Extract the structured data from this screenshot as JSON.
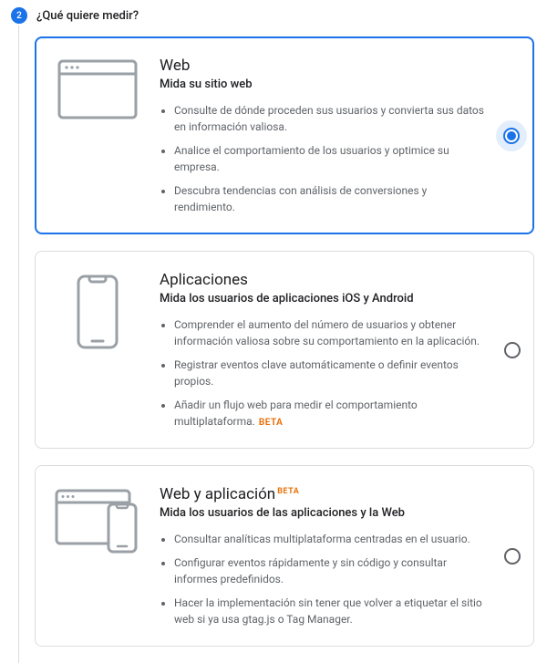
{
  "step": {
    "number": "2",
    "title": "¿Qué quiere medir?"
  },
  "options": [
    {
      "title": "Web",
      "subtitle": "Mida su sitio web",
      "bullets": [
        "Consulte de dónde proceden sus usuarios y convierta sus datos en información valiosa.",
        "Analice el comportamiento de los usuarios y optimice su empresa.",
        "Descubra tendencias con análisis de conversiones y rendimiento."
      ],
      "selected": true
    },
    {
      "title": "Aplicaciones",
      "subtitle": "Mida los usuarios de aplicaciones iOS y Android",
      "bullets": [
        "Comprender el aumento del número de usuarios y obtener información valiosa sobre su comportamiento en la aplicación.",
        "Registrar eventos clave automáticamente o definir eventos propios.",
        "Añadir un flujo web para medir el comportamiento multiplataforma."
      ],
      "bullet_badge_index": 2,
      "bullet_badge": "BETA",
      "selected": false
    },
    {
      "title": "Web y aplicación",
      "title_badge": "BETA",
      "subtitle": "Mida los usuarios de las aplicaciones y la Web",
      "bullets": [
        "Consultar analíticas multiplataforma centradas en el usuario.",
        "Configurar eventos rápidamente y sin código y consultar informes predefinidos.",
        "Hacer la implementación sin tener que volver a etiquetar el sitio web si ya usa gtag.js o Tag Manager."
      ],
      "selected": false
    }
  ]
}
